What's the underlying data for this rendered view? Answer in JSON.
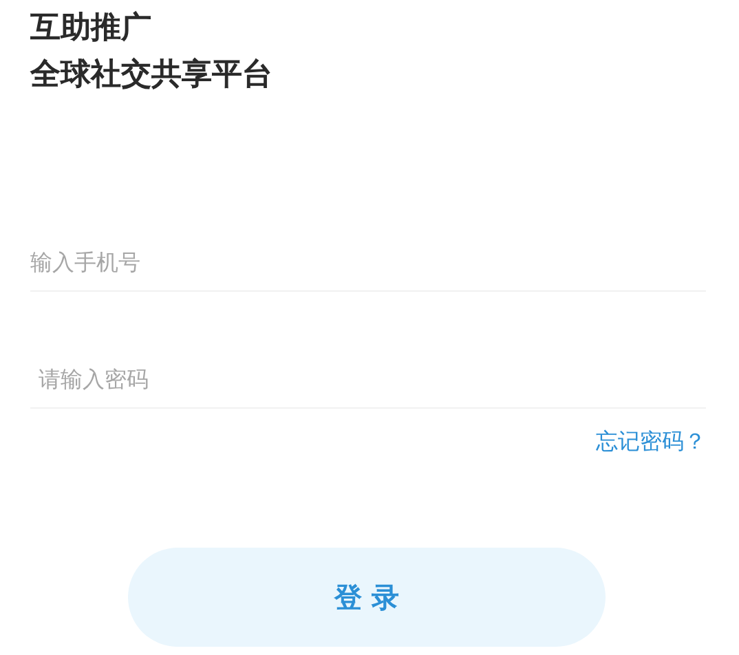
{
  "headline": [
    "互助推广",
    "全球社交共享平台"
  ],
  "phone_field": {
    "placeholder": "输入手机号"
  },
  "password_field": {
    "placeholder": "请输入密码"
  },
  "forgot_password_link": "忘记密码？",
  "login_button": "登 录"
}
